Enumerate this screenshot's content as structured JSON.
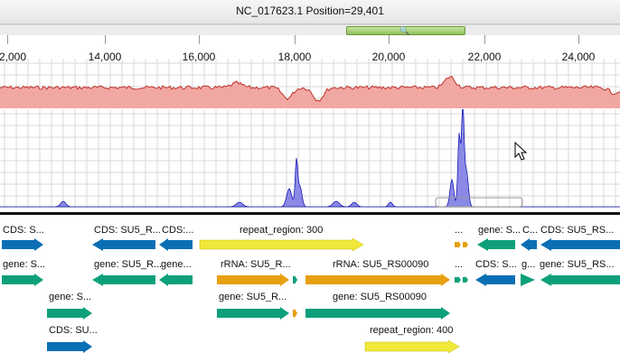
{
  "window": {
    "title": "NC_017623.1 Position=29,401"
  },
  "scrollbar": {
    "thumb_icon": "magnifier-icon"
  },
  "ruler": {
    "ticks": [
      "2,000",
      "14,000",
      "16,000",
      "18,000",
      "20,000",
      "22,000",
      "24,000"
    ]
  },
  "colors": {
    "gc_fill": "#f2a8a2",
    "gc_line": "#c0312b",
    "coverage_fill": "#8a8ae6",
    "coverage_line": "#1a1ab8",
    "cds": "#0a6fb4",
    "gene": "#0ea07a",
    "repeat": "#f0e83a",
    "rrna": "#e6a010"
  },
  "features": {
    "row1": [
      {
        "label": "CDS: S...",
        "type": "cds"
      },
      {
        "label": "CDS: SU5_R...",
        "type": "cds"
      },
      {
        "label": "CDS:...",
        "type": "cds"
      },
      {
        "label": "repeat_region: 300",
        "type": "repeat"
      },
      {
        "label": "...",
        "type": "rrna"
      },
      {
        "label": "gene: S...",
        "type": "gene"
      },
      {
        "label": "C...",
        "type": "cds"
      },
      {
        "label": "CDS: SU5_RS...",
        "type": "cds"
      }
    ],
    "row2": [
      {
        "label": "gene: S...",
        "type": "gene"
      },
      {
        "label": "gene: SU5_R...",
        "type": "gene"
      },
      {
        "label": "gene...",
        "type": "gene"
      },
      {
        "label": "rRNA: SU5_R...",
        "type": "rrna"
      },
      {
        "label": "rRNA: SU5_RS00090",
        "type": "rrna"
      },
      {
        "label": "...",
        "type": "gene"
      },
      {
        "label": "CDS: S...",
        "type": "cds"
      },
      {
        "label": "g...",
        "type": "gene"
      },
      {
        "label": "gene: SU5_RS...",
        "type": "gene"
      }
    ],
    "row3": [
      {
        "label": "gene: S...",
        "type": "gene"
      },
      {
        "label": "gene: SU5_R...",
        "type": "gene"
      },
      {
        "label": "gene: SU5_RS00090",
        "type": "gene"
      }
    ],
    "row4": [
      {
        "label": "CDS: SU...",
        "type": "cds"
      },
      {
        "label": "repeat_region: 400",
        "type": "repeat"
      }
    ]
  }
}
